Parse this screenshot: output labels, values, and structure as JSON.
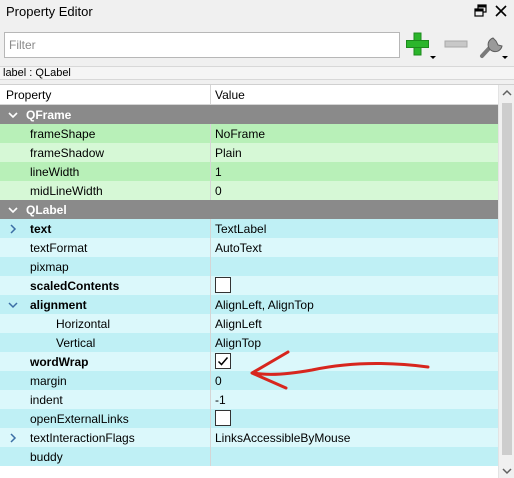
{
  "window": {
    "title": "Property Editor"
  },
  "toolbar": {
    "filter_placeholder": "Filter",
    "filter_value": ""
  },
  "object_path": "label : QLabel",
  "table": {
    "header_property": "Property",
    "header_value": "Value"
  },
  "groups": {
    "qframe": "QFrame",
    "qlabel": "QLabel"
  },
  "qframe_rows": [
    {
      "label": "frameShape",
      "value": "NoFrame"
    },
    {
      "label": "frameShadow",
      "value": "Plain"
    },
    {
      "label": "lineWidth",
      "value": "1"
    },
    {
      "label": "midLineWidth",
      "value": "0"
    }
  ],
  "qlabel_rows": {
    "text": {
      "label": "text",
      "value": "TextLabel"
    },
    "textFormat": {
      "label": "textFormat",
      "value": "AutoText"
    },
    "pixmap": {
      "label": "pixmap",
      "value": ""
    },
    "scaledContents": {
      "label": "scaledContents",
      "checked": false
    },
    "alignment": {
      "label": "alignment",
      "value": "AlignLeft, AlignTop"
    },
    "horizontal": {
      "label": "Horizontal",
      "value": "AlignLeft"
    },
    "vertical": {
      "label": "Vertical",
      "value": "AlignTop"
    },
    "wordWrap": {
      "label": "wordWrap",
      "checked": true
    },
    "margin": {
      "label": "margin",
      "value": "0"
    },
    "indent": {
      "label": "indent",
      "value": "-1"
    },
    "openExternalLinks": {
      "label": "openExternalLinks",
      "checked": false
    },
    "textInteractionFlags": {
      "label": "textInteractionFlags",
      "value": "LinksAccessibleByMouse"
    },
    "buddy": {
      "label": "buddy",
      "value": ""
    }
  },
  "colors": {
    "group_header": "#8a8a8a",
    "qframe_row": "#b8f0b8",
    "qframe_row_alt": "#d6f8d6",
    "qlabel_row": "#bff0f5",
    "qlabel_row_alt": "#dbf8fb",
    "annotation_arrow": "#d7261e",
    "add_icon": "#2bb52b"
  },
  "icons": {
    "float": "float-icon",
    "close": "close-icon",
    "add": "plus-icon",
    "remove": "minus-icon",
    "configure": "wrench-icon"
  }
}
